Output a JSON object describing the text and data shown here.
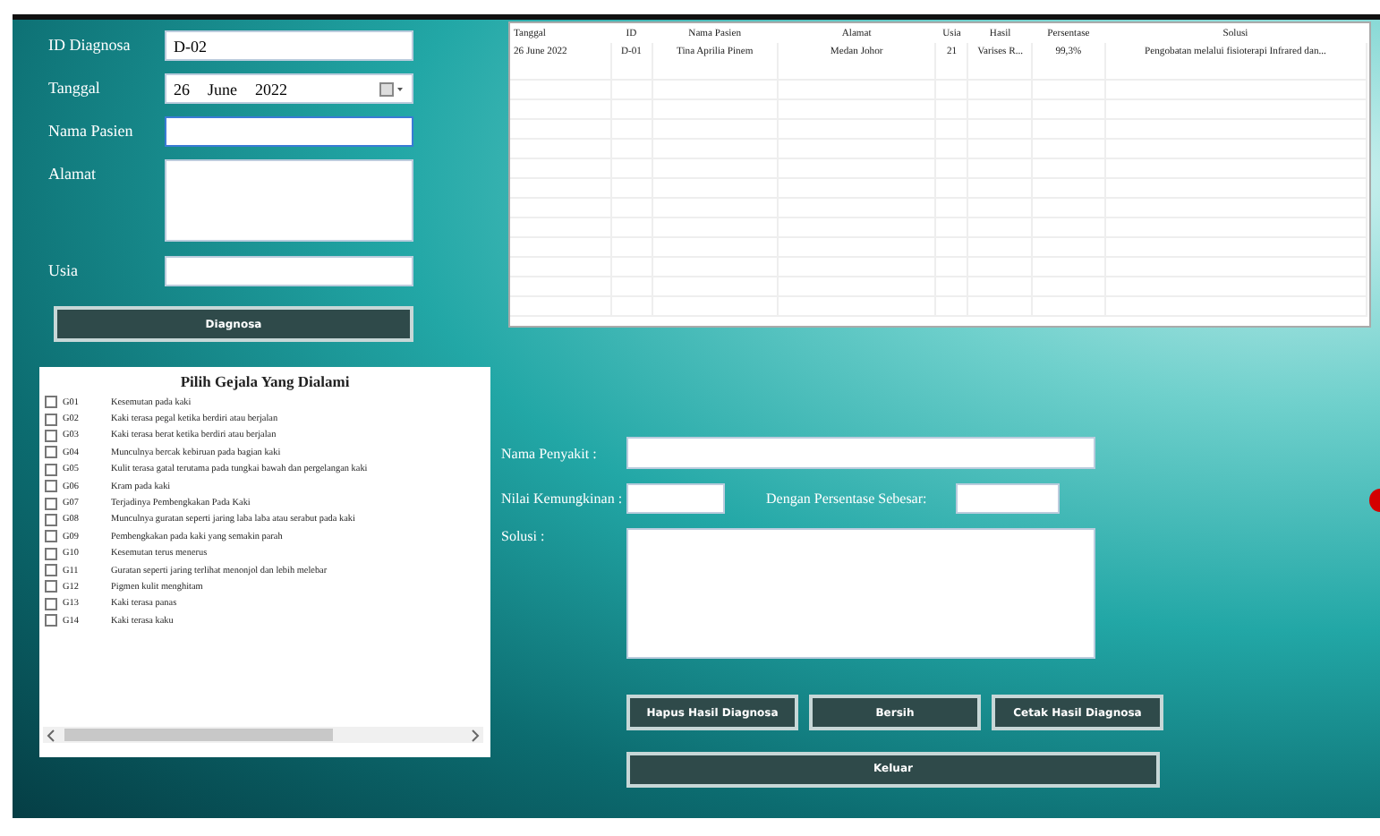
{
  "patient_form": {
    "fields": [
      {
        "label": "ID Diagnosa",
        "kind": "text",
        "value": "D-02"
      },
      {
        "label": "Tanggal",
        "kind": "date",
        "day": "26",
        "month": "June",
        "year": "2022"
      },
      {
        "label": "Nama Pasien",
        "kind": "text",
        "focused": true
      },
      {
        "label": "Alamat",
        "kind": "area"
      },
      {
        "label": "Usia",
        "kind": "text"
      }
    ],
    "button": "Diagnosa"
  },
  "symptoms": {
    "title": "Pilih Gejala Yang Dialami",
    "items": [
      {
        "code": "G01",
        "text": "Kesemutan pada kaki",
        "checked": false
      },
      {
        "code": "G02",
        "text": "Kaki terasa pegal ketika berdiri atau berjalan",
        "checked": false
      },
      {
        "code": "G03",
        "text": "Kaki terasa berat ketika berdiri atau berjalan",
        "checked": false
      },
      {
        "code": "G04",
        "text": "Munculnya bercak kebiruan pada bagian kaki",
        "checked": false
      },
      {
        "code": "G05",
        "text": "Kulit terasa gatal terutama pada tungkai bawah dan pergelangan kaki",
        "checked": false
      },
      {
        "code": "G06",
        "text": "Kram pada kaki",
        "checked": false
      },
      {
        "code": "G07",
        "text": "Terjadinya Pembengkakan Pada Kaki",
        "checked": false
      },
      {
        "code": "G08",
        "text": "Munculnya guratan seperti jaring laba laba atau serabut pada kaki",
        "checked": false
      },
      {
        "code": "G09",
        "text": "Pembengkakan pada kaki yang semakin parah",
        "checked": false
      },
      {
        "code": "G10",
        "text": "Kesemutan terus menerus",
        "checked": false
      },
      {
        "code": "G11",
        "text": "Guratan seperti jaring terlihat menonjol dan lebih melebar",
        "checked": false
      },
      {
        "code": "G12",
        "text": "Pigmen kulit menghitam",
        "checked": false
      },
      {
        "code": "G13",
        "text": "Kaki terasa panas",
        "checked": false
      },
      {
        "code": "G14",
        "text": "Kaki terasa kaku",
        "checked": false
      }
    ]
  },
  "table": {
    "columns": [
      "Tanggal",
      "ID",
      "Nama Pasien",
      "Alamat",
      "Usia",
      "Hasil",
      "Persentase",
      "Solusi"
    ],
    "rows": [
      [
        "26 June 2022",
        "D-01",
        "Tina Aprilia Pinem",
        "Medan Johor",
        "21",
        "Varises R...",
        "99,3%",
        "Pengobatan melalui fisioterapi Infrared dan..."
      ]
    ]
  },
  "result_form": {
    "nama_penyakit": {
      "label": "Nama Penyakit :"
    },
    "nilai_kemungkinan": {
      "label": "Nilai Kemungkinan :"
    },
    "persentase": {
      "label": "Dengan Persentase Sebesar:"
    },
    "solusi": {
      "label": "Solusi :"
    }
  },
  "buttons": [
    "Hapus Hasil Diagnosa",
    "Bersih",
    "Cetak Hasil Diagnosa"
  ],
  "exit_button": "Keluar"
}
